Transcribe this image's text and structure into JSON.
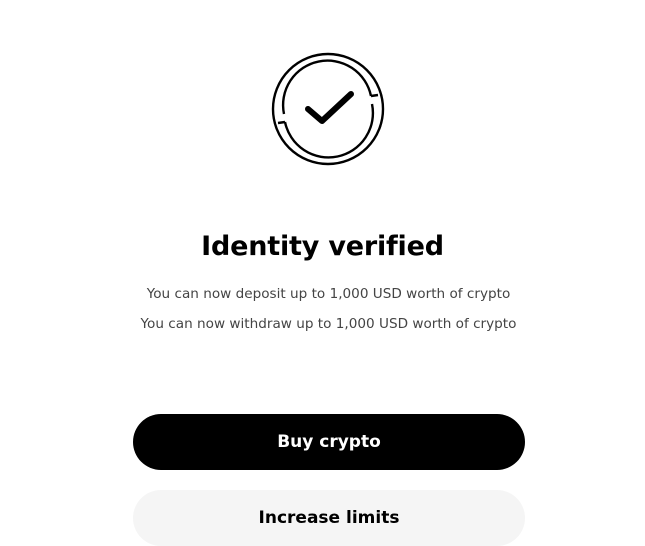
{
  "status": {
    "icon": "check-circle-icon",
    "title": "Identity verified",
    "deposit_limit_text": "You can now deposit up to 1,000 USD worth of crypto",
    "withdraw_limit_text": "You can now withdraw up to 1,000 USD worth of crypto"
  },
  "actions": {
    "primary_label": "Buy crypto",
    "secondary_label": "Increase limits"
  },
  "colors": {
    "primary_button_bg": "#000000",
    "primary_button_text": "#ffffff",
    "secondary_button_bg": "#f5f5f5",
    "secondary_text": "#444444"
  }
}
